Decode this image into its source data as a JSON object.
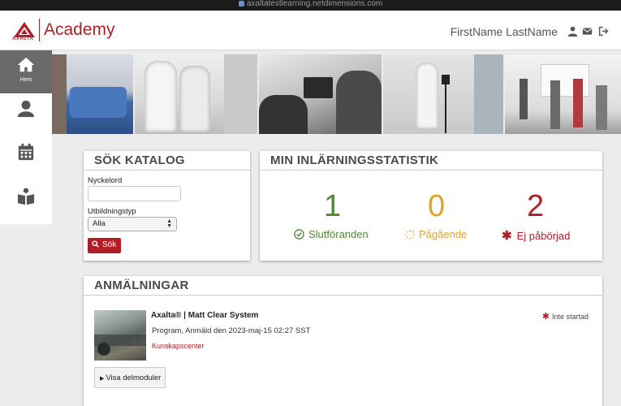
{
  "browser": {
    "url": "axaltatestlearning.netdimensions.com"
  },
  "header": {
    "brand_small": "AXALTA",
    "brand": "Academy",
    "username": "FirstName LastName",
    "icons": [
      "user-icon",
      "mail-icon",
      "logout-icon"
    ]
  },
  "sidebar": {
    "items": [
      {
        "label": "Hem",
        "icon": "home-icon",
        "active": true
      },
      {
        "label": "",
        "icon": "profile-icon",
        "active": false
      },
      {
        "label": "",
        "icon": "calendar-icon",
        "active": false
      },
      {
        "label": "",
        "icon": "book-reader-icon",
        "active": false
      }
    ]
  },
  "banner": {
    "panels": 5
  },
  "search": {
    "title": "SÖK KATALOG",
    "keyword_label": "Nyckelord",
    "keyword_value": "",
    "type_label": "Utbildningstyp",
    "type_selected": "Alla",
    "button_label": "Sök"
  },
  "stats": {
    "title": "MIN INLÄRNINGSSTATISTIK",
    "items": [
      {
        "value": "1",
        "label": "Slutföranden",
        "color": "#4f8a2f",
        "icon": "check-circle-icon"
      },
      {
        "value": "0",
        "label": "Pågående",
        "color": "#e0a330",
        "icon": "spinner-icon"
      },
      {
        "value": "2",
        "label": "Ej påbörjad",
        "color": "#b21e28",
        "icon": "asterisk-icon"
      }
    ]
  },
  "enrollments": {
    "title": "ANMÄLNINGAR",
    "items": [
      {
        "title": "Axalta® | Matt Clear System",
        "meta": "Program, Anmäld den 2023-maj-15 02:27 SST",
        "link": "Kunskapscenter",
        "status": "Inte startad",
        "modules_button": "Visa delmoduler"
      }
    ]
  },
  "colors": {
    "brand": "#b21e28",
    "sidebar_active": "#6a6a6a",
    "background": "#ececec"
  }
}
